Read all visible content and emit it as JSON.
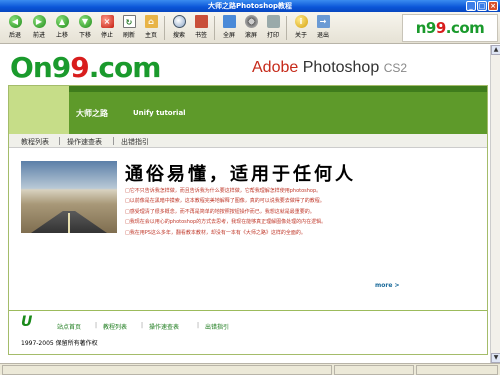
{
  "window": {
    "title": "大师之路Photoshop教程"
  },
  "toolbar": {
    "back": "后退",
    "forward": "前进",
    "up": "上移",
    "down": "下移",
    "stop": "停止",
    "refresh": "刷新",
    "home": "主页",
    "search": "搜索",
    "bookmark": "书签",
    "fullscreen": "全屏",
    "scroll": "滚屏",
    "print": "打印",
    "about": "关于",
    "exit": "退出",
    "logo_green": "n9",
    "logo_red": "9",
    "logo_end": ".com"
  },
  "banner": {
    "logo_o": "O",
    "logo_n9": "n9",
    "logo_red": "9",
    "logo_com": ".com",
    "adobe_word": "Adobe",
    "photoshop_word": "Photoshop",
    "cs2_word": "CS2"
  },
  "header": {
    "site_title": "大师之路",
    "site_subtitle": "Unify tutorial"
  },
  "subnav": {
    "items": [
      "教程列表",
      "操作速查表",
      "出错指引"
    ]
  },
  "hero": {
    "headline": "通俗易懂，适用于任何人",
    "lines": [
      "□它不只告诉我怎样做，而且告诉我为什么要这样做，它帮我理解怎样使用photoshop。",
      "□以前像是在黑暗中摸索，这本教程完美地解释了图像，真的可以说我要去做得了的教程。",
      "□感受理清了很多概念，而不再是简单的地按照按钮操作而已，我想这就是最重要的。",
      "□我现在会以用心的photoshop的方式去思考，我现在能够真正理解图像处理的内在逻辑。",
      "□我在用PS这么多年，翻看教本教材，却没有一本有《大师之路》这样的全面的。"
    ],
    "more": "more >"
  },
  "footer": {
    "links": [
      "站点首页",
      "教程列表",
      "操作速查表",
      "出错指引"
    ],
    "copyright": "1997-2005 保留所有著作权"
  },
  "colors": {
    "accent_green": "#5e9a2a",
    "brand_green": "#1a9a2c",
    "brand_red": "#d81d1d",
    "titlebar_blue": "#0a55d8"
  }
}
